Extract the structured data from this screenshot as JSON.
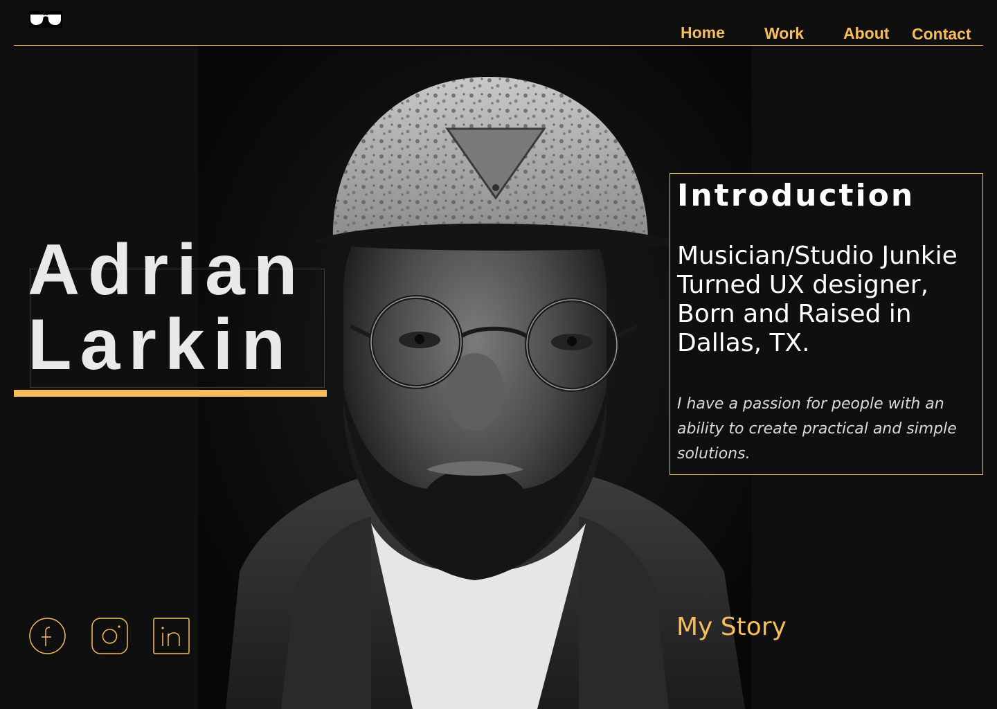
{
  "header": {
    "logo_icon": "sunglasses-icon",
    "nav": [
      {
        "label": "Home"
      },
      {
        "label": "Work"
      },
      {
        "label": "About"
      },
      {
        "label": "Contact"
      }
    ]
  },
  "hero": {
    "first_name": "Adrian",
    "last_name": "Larkin",
    "portrait_icon": "portrait-photo"
  },
  "intro": {
    "title": "Introduction",
    "headline": "Musician/Studio Junkie Turned UX designer, Born and Raised in Dallas, TX.",
    "body": "I have a passion for people with an ability to create practical and simple solutions."
  },
  "cta": {
    "label": "My Story"
  },
  "social": [
    {
      "icon": "facebook-icon"
    },
    {
      "icon": "instagram-icon"
    },
    {
      "icon": "linkedin-icon"
    }
  ],
  "colors": {
    "background": "#0f0f0f",
    "accent": "#f8bd5b",
    "text": "#ffffff"
  }
}
